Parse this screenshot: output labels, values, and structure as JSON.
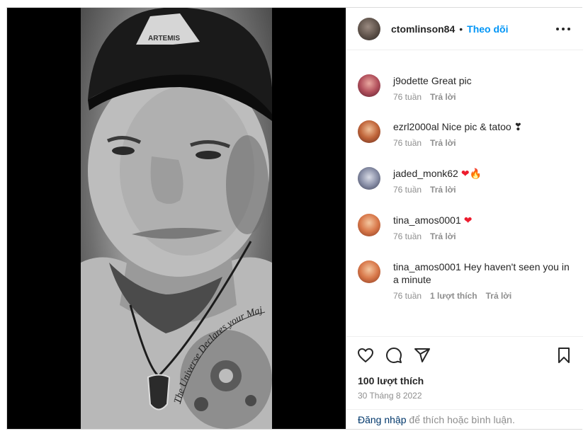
{
  "post": {
    "owner": "ctomlinson84",
    "separator": "•",
    "follow_label": "Theo dõi",
    "cap_logo_text": "ARTEMIS",
    "tattoo_text": "The Universe Declares your Majesty"
  },
  "comments": [
    {
      "user": "j9odette",
      "text": "Great pic",
      "time": "76 tuần",
      "likes": "",
      "reply": "Trả lời"
    },
    {
      "user": "ezrl2000al",
      "text": "Nice pic & tatoo ❣",
      "time": "76 tuần",
      "likes": "",
      "reply": "Trả lời"
    },
    {
      "user": "jaded_monk62",
      "text": "❤🔥",
      "time": "76 tuần",
      "likes": "",
      "reply": "Trả lời"
    },
    {
      "user": "tina_amos0001",
      "text": "❤",
      "time": "76 tuần",
      "likes": "",
      "reply": "Trả lời"
    },
    {
      "user": "tina_amos0001",
      "text": "Hey haven't seen you in a minute",
      "time": "76 tuần",
      "likes": "1 lượt thích",
      "reply": "Trả lời"
    }
  ],
  "stats": {
    "likes": "100 lượt thích",
    "date": "30 Tháng 8 2022"
  },
  "login": {
    "link": "Đăng nhập",
    "suffix": " để thích hoặc bình luận."
  },
  "icons": {
    "like": "heart-outline-icon",
    "comment": "speech-bubble-icon",
    "share": "paper-plane-icon",
    "save": "bookmark-icon",
    "more": "more-options-icon"
  },
  "colors": {
    "follow": "#0095f6",
    "link": "#00376b",
    "muted": "#8e8e8e",
    "heart": "#ed1c2e"
  }
}
